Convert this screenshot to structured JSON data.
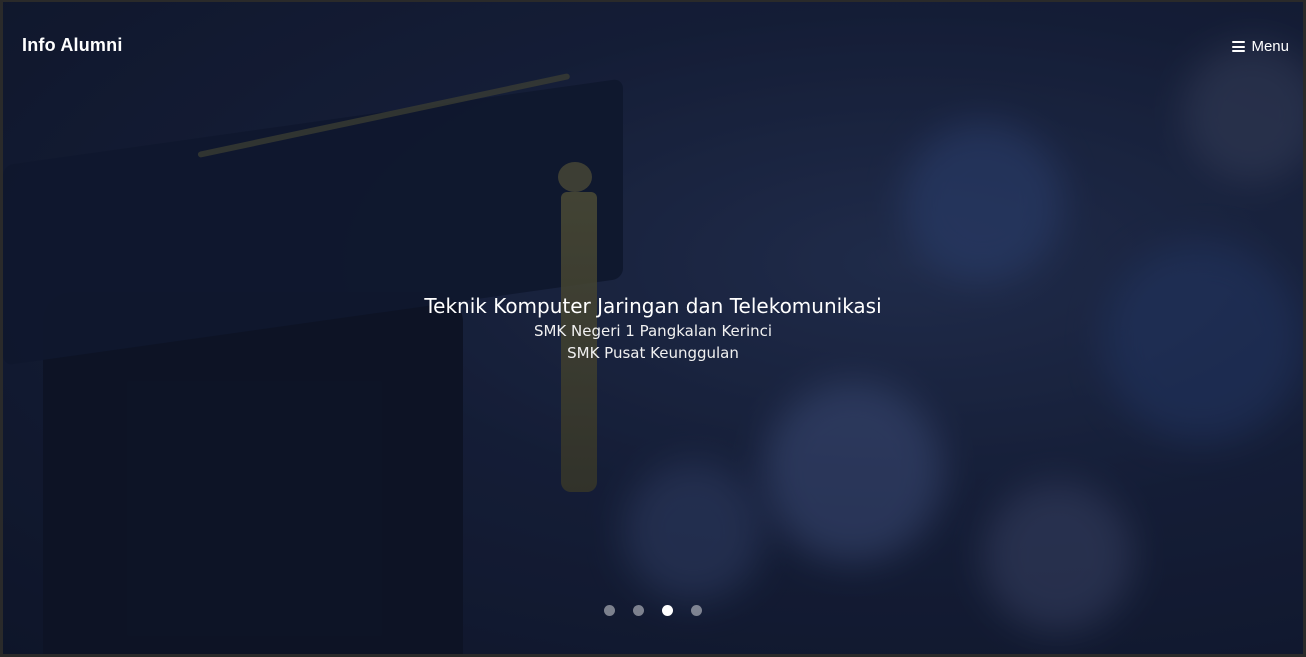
{
  "navbar": {
    "brand": "Info Alumni",
    "menu_label": "Menu",
    "menu_icon": "hamburger-icon"
  },
  "carousel": {
    "active_index": 2,
    "slide_count": 4,
    "caption": {
      "title": "Teknik Komputer Jaringan dan Telekomunikasi",
      "line1": "SMK Negeri 1 Pangkalan Kerinci",
      "line2": "SMK Pusat Keunggulan"
    }
  },
  "colors": {
    "text": "#ffffff",
    "background": "#1a2440",
    "indicator_inactive": "rgba(255,255,255,0.45)",
    "indicator_active": "#ffffff"
  }
}
